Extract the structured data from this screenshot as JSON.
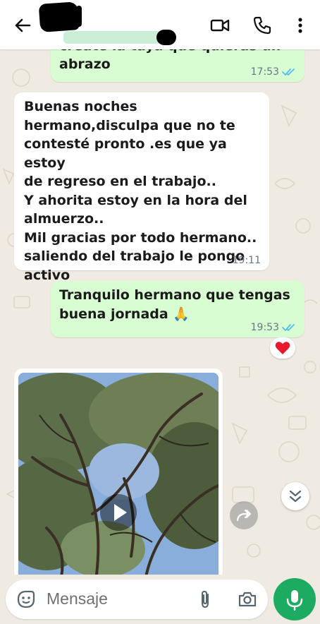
{
  "header": {
    "contact_name": "▇▇▇▇ ▇▇▇▇▇",
    "icons": [
      "back-arrow-icon",
      "video-call-icon",
      "phone-call-icon",
      "more-options-icon"
    ]
  },
  "messages": [
    {
      "direction": "out",
      "text_partial": "créate la taya que quieras un",
      "text": "abrazo",
      "time": "17:53",
      "status": "read"
    },
    {
      "direction": "in",
      "text": "Buenas noches\nhermano,disculpa que no te\ncontesté pronto .es que ya estoy\nde regreso en el trabajo..\nY ahorita estoy en la hora del\nalmuerzo..\nMil gracias por todo hermano..\nsaliendo del trabajo le pongo\nactivo",
      "time": "19:11"
    },
    {
      "direction": "out",
      "text": "Tranquilo hermano que tengas\nbuena jornada 🙏",
      "time": "19:53",
      "status": "read",
      "reaction": "❤️"
    },
    {
      "direction": "in",
      "type": "video"
    }
  ],
  "composer": {
    "placeholder": "Mensaje",
    "icons": [
      "emoji-sticker-icon",
      "attach-paperclip-icon",
      "camera-icon",
      "microphone-icon"
    ]
  },
  "colors": {
    "outgoing_bubble": "#d9fdd3",
    "incoming_bubble": "#ffffff",
    "background": "#efeae2",
    "read_ticks": "#53bdeb",
    "mic_button": "#1daa61"
  }
}
